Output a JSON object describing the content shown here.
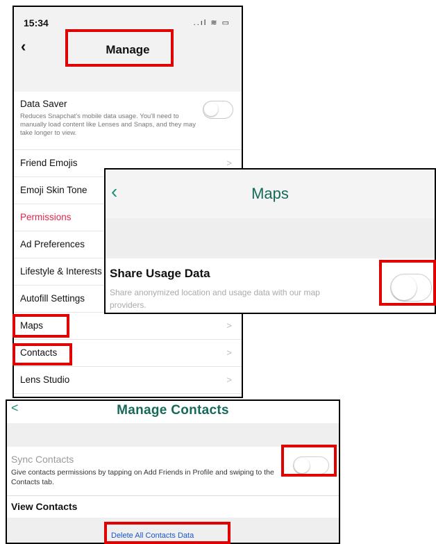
{
  "phone": {
    "time": "15:34",
    "status_icons": "..ıl ≋ ▭",
    "nav_title": "Manage",
    "data_saver": {
      "label": "Data Saver",
      "description": "Reduces Snapchat's mobile data usage. You'll need to manually load content like Lenses and Snaps, and they may take longer to view."
    },
    "rows": [
      {
        "label": "Friend Emojis"
      },
      {
        "label": "Emoji Skin Tone"
      },
      {
        "label": "Permissions"
      },
      {
        "label": "Ad Preferences"
      },
      {
        "label": "Lifestyle & Interests"
      },
      {
        "label": "Autofill Settings"
      },
      {
        "label": "Maps"
      },
      {
        "label": "Contacts"
      },
      {
        "label": "Lens Studio"
      }
    ]
  },
  "maps_panel": {
    "title": "Maps",
    "share_usage_label": "Share Usage Data",
    "share_usage_desc": "Share anonymized location and usage data with our map providers."
  },
  "contacts_panel": {
    "title": "Manage Contacts",
    "sync_label": "Sync Contacts",
    "sync_desc": "Give contacts permissions by tapping on Add Friends in Profile and swiping to the Contacts tab.",
    "view_label": "View Contacts",
    "delete_label": "Delete All Contacts Data"
  },
  "colors": {
    "highlight": "#e00000",
    "teal": "#17695a",
    "permissions": "#e0264a"
  },
  "icons": {
    "back": "chevron-left-icon",
    "row": "chevron-right-icon"
  }
}
